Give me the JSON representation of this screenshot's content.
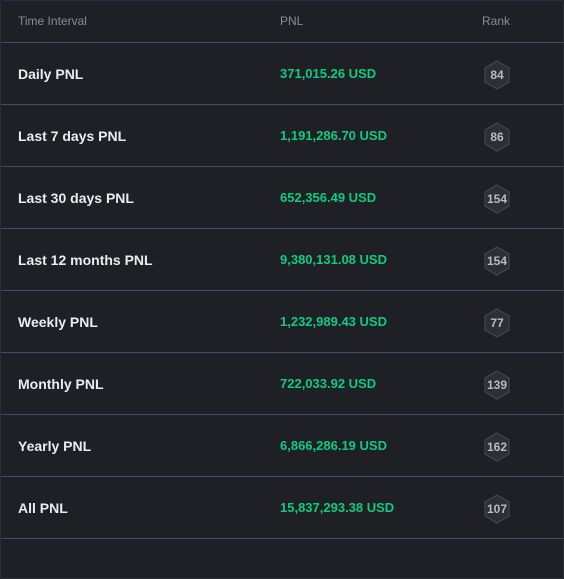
{
  "header": {
    "time_interval": "Time Interval",
    "pnl": "PNL",
    "rank": "Rank"
  },
  "rows": [
    {
      "label": "Daily PNL",
      "value": "371,015.26 USD",
      "rank": "84"
    },
    {
      "label": "Last 7 days PNL",
      "value": "1,191,286.70 USD",
      "rank": "86"
    },
    {
      "label": "Last 30 days PNL",
      "value": "652,356.49 USD",
      "rank": "154"
    },
    {
      "label": "Last 12 months PNL",
      "value": "9,380,131.08 USD",
      "rank": "154"
    },
    {
      "label": "Weekly PNL",
      "value": "1,232,989.43 USD",
      "rank": "77"
    },
    {
      "label": "Monthly PNL",
      "value": "722,033.92 USD",
      "rank": "139"
    },
    {
      "label": "Yearly PNL",
      "value": "6,866,286.19 USD",
      "rank": "162"
    },
    {
      "label": "All PNL",
      "value": "15,837,293.38 USD",
      "rank": "107"
    }
  ],
  "colors": {
    "positive": "#0ecb81",
    "background": "#1e2026",
    "divider": "#474d57"
  },
  "icons": {
    "rank_badge": "hexagon-badge-icon"
  }
}
